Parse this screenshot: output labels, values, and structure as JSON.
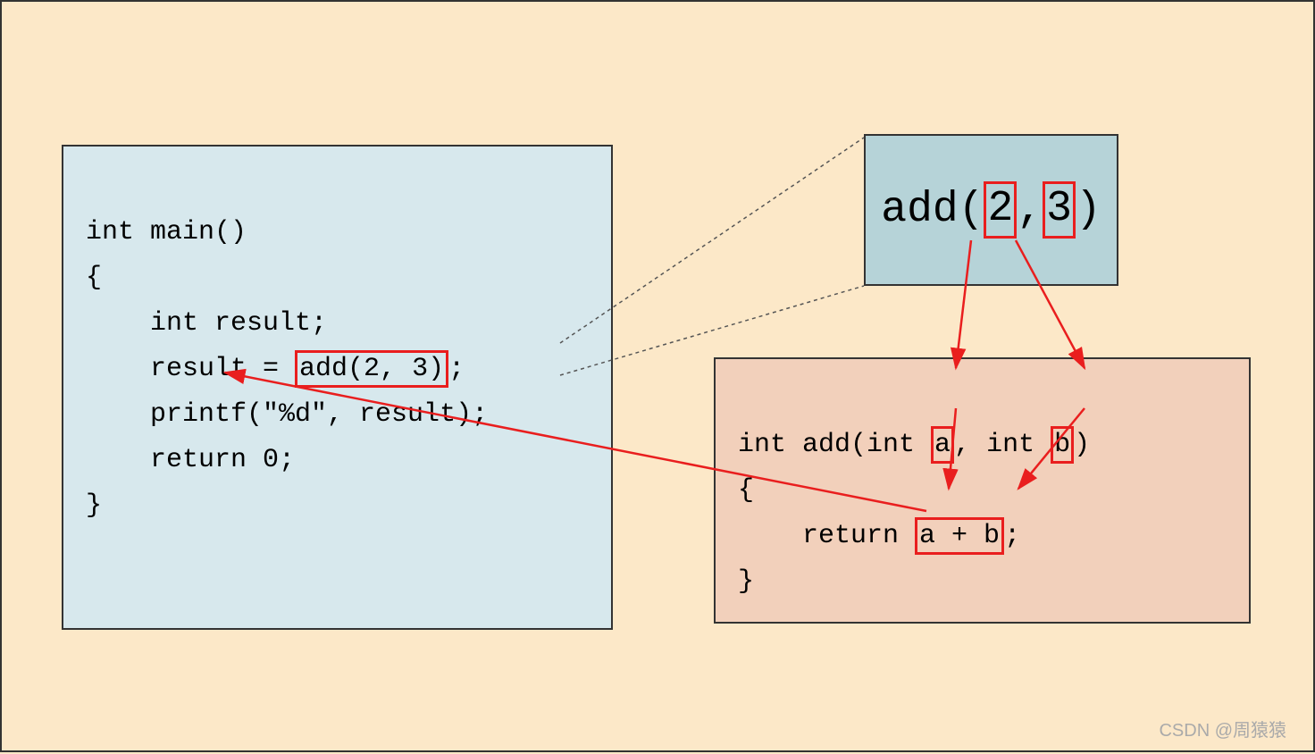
{
  "main": {
    "line1": "int main()",
    "line2": "{",
    "line3": "    int result;",
    "line4_a": "    result = ",
    "line4_b": "add(2, 3)",
    "line4_c": ";",
    "line5": "    printf(\"%d\", result);",
    "line6": "    return 0;",
    "line7": "}"
  },
  "callout": {
    "prefix": "add(",
    "arg1": "2",
    "comma": ",",
    "arg2": "3",
    "suffix": ")"
  },
  "add": {
    "line1_a": "int add(int ",
    "line1_b": "a",
    "line1_c": ", int ",
    "line1_d": "b",
    "line1_e": ")",
    "line2": "{",
    "line3_a": "    return ",
    "line3_b": "a + b",
    "line3_c": ";",
    "line4": "}"
  },
  "watermark": "CSDN @周猿猿",
  "colors": {
    "bg": "#fce8c8",
    "blue_light": "#d7e8ed",
    "blue_dark": "#b6d3d8",
    "orange": "#f2d0bb",
    "highlight": "#e91e1e",
    "border": "#333"
  }
}
